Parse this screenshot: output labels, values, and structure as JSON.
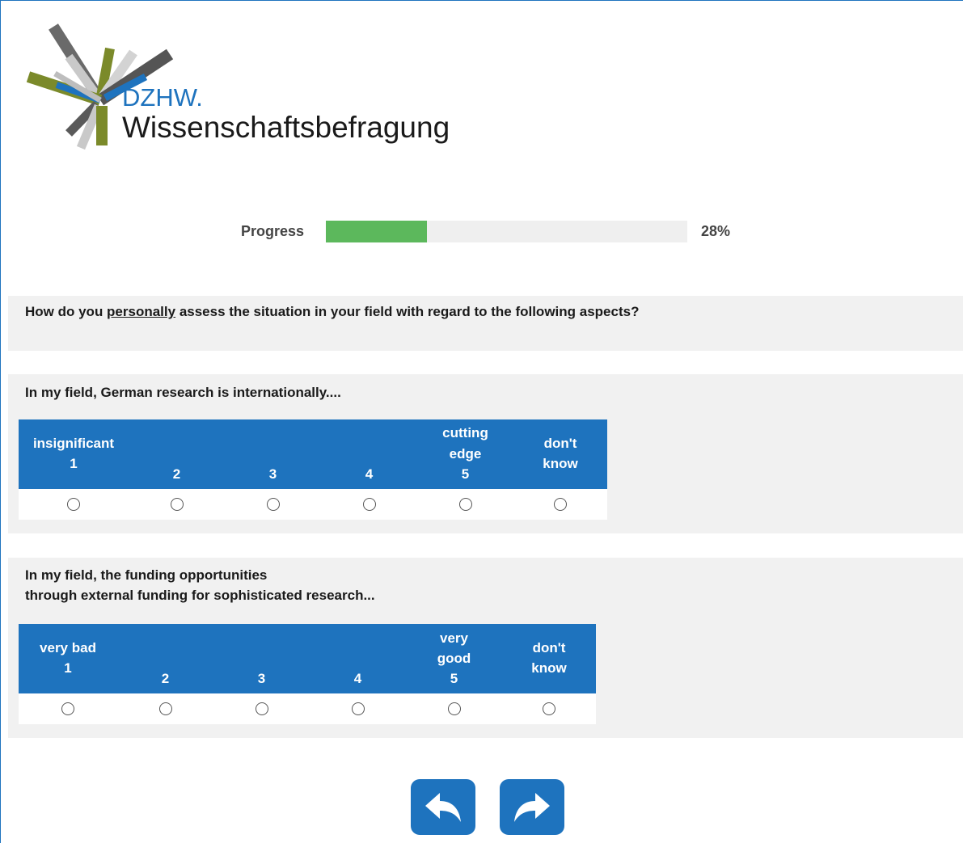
{
  "logo": {
    "org": "DZHW.",
    "name": "Wissenschaftsbefragung"
  },
  "progress": {
    "label": "Progress",
    "percent_text": "28%",
    "value": 0.28,
    "color": "#5cb85c"
  },
  "question": {
    "prefix": "How do you ",
    "emphasis": "personally",
    "suffix": " assess the situation in your field with regard to the following aspects?"
  },
  "items": [
    {
      "text_lines": [
        "In my field, German research is internationally...."
      ],
      "scale": [
        {
          "lines": [
            "insignificant",
            "1"
          ]
        },
        {
          "lines": [
            "2"
          ]
        },
        {
          "lines": [
            "3"
          ]
        },
        {
          "lines": [
            "4"
          ]
        },
        {
          "lines": [
            "cutting",
            "edge",
            "5"
          ]
        },
        {
          "lines": [
            "don't",
            "know"
          ]
        }
      ]
    },
    {
      "text_lines": [
        "In my field, the funding opportunities",
        "through external funding for sophisticated research..."
      ],
      "scale": [
        {
          "lines": [
            "very bad",
            "1"
          ]
        },
        {
          "lines": [
            "2"
          ]
        },
        {
          "lines": [
            "3"
          ]
        },
        {
          "lines": [
            "4"
          ]
        },
        {
          "lines": [
            "very",
            "good",
            "5"
          ]
        },
        {
          "lines": [
            "don't",
            "know"
          ]
        }
      ]
    }
  ],
  "nav": {
    "back_icon": "undo-arrow-icon",
    "forward_icon": "redo-arrow-icon"
  },
  "colors": {
    "accent": "#1e73be",
    "band": "#f1f1f1"
  }
}
